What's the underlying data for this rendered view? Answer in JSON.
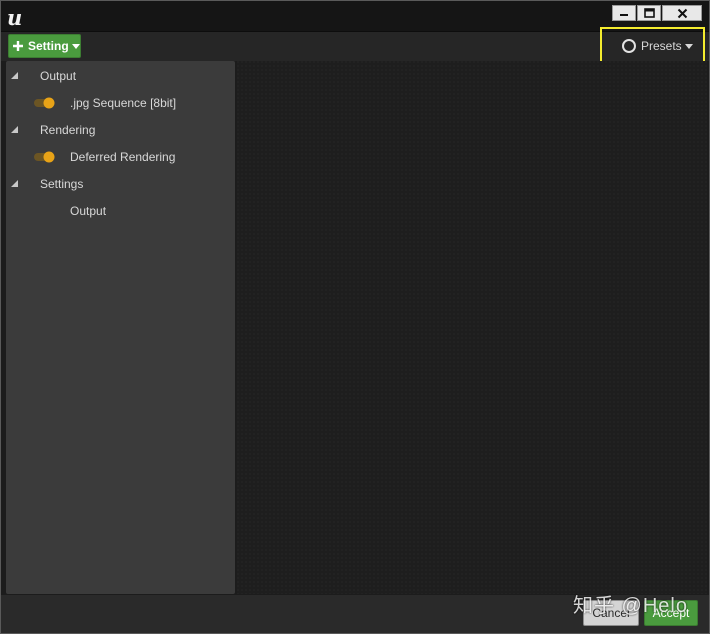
{
  "window": {
    "logo_icon": "unreal-engine-logo",
    "controls": {
      "minimize_icon": "minimize-icon",
      "maximize_icon": "maximize-icon",
      "close_icon": "close-icon"
    }
  },
  "toolbar": {
    "setting_label": "Setting",
    "presets_label": "Presets"
  },
  "tree": {
    "sections": [
      {
        "label": "Output",
        "children": [
          {
            "label": ".jpg Sequence [8bit]",
            "enabled": true
          }
        ]
      },
      {
        "label": "Rendering",
        "children": [
          {
            "label": "Deferred Rendering",
            "enabled": true
          }
        ]
      },
      {
        "label": "Settings",
        "children": [
          {
            "label": "Output",
            "enabled": null
          }
        ]
      }
    ]
  },
  "footer": {
    "cancel_label": "Cancel",
    "accept_label": "Accept"
  },
  "watermark": "知乎 @Helo",
  "colors": {
    "accent_green": "#4a9b3e",
    "toggle_orange": "#e8a317",
    "highlight_yellow": "#f4ec2e",
    "panel_bg": "#3b3b3b",
    "content_bg": "#1e1e1e"
  }
}
